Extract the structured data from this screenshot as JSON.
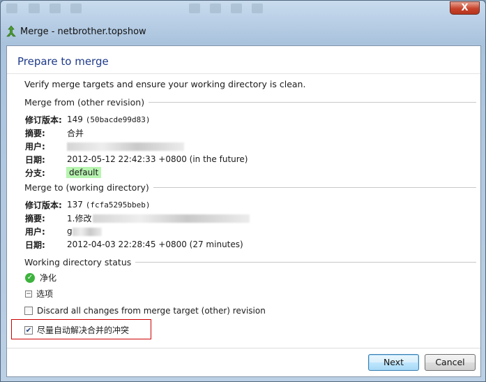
{
  "window": {
    "title": "Merge - netbrother.topshow",
    "close_glyph": "X"
  },
  "page": {
    "heading": "Prepare to merge",
    "intro": "Verify merge targets and ensure your working directory is clean."
  },
  "merge_from": {
    "label": "Merge from (other revision)",
    "fields": [
      {
        "key": "修订版本:",
        "value": "149",
        "hash": "(50bacde99d83)"
      },
      {
        "key": "摘要:",
        "value": "合并"
      },
      {
        "key": "用户:",
        "value": ""
      },
      {
        "key": "日期:",
        "value": "2012-05-12 22:42:33 +0800 (in the future)"
      },
      {
        "key": "分支:",
        "value": "default"
      }
    ]
  },
  "merge_to": {
    "label": "Merge to (working directory)",
    "fields": [
      {
        "key": "修订版本:",
        "value": "137",
        "hash": "(fcfa5295bbeb)"
      },
      {
        "key": "摘要:",
        "value": "1.修改"
      },
      {
        "key": "用户:",
        "value": "g"
      },
      {
        "key": "日期:",
        "value": "2012-04-03 22:28:45 +0800 (27 minutes)"
      }
    ]
  },
  "status": {
    "label": "Working directory status",
    "clean_text": "净化",
    "options_text": "选项"
  },
  "options": {
    "discard": {
      "label": "Discard all changes from merge target (other) revision",
      "checked": false
    },
    "autoresolve": {
      "label": "尽量自动解决合并的冲突",
      "checked": true
    }
  },
  "buttons": {
    "next": "Next",
    "cancel": "Cancel"
  },
  "colors": {
    "heading": "#1e3a8a",
    "branch_badge": "#b7f4b0",
    "highlight_border": "#cc0000"
  }
}
